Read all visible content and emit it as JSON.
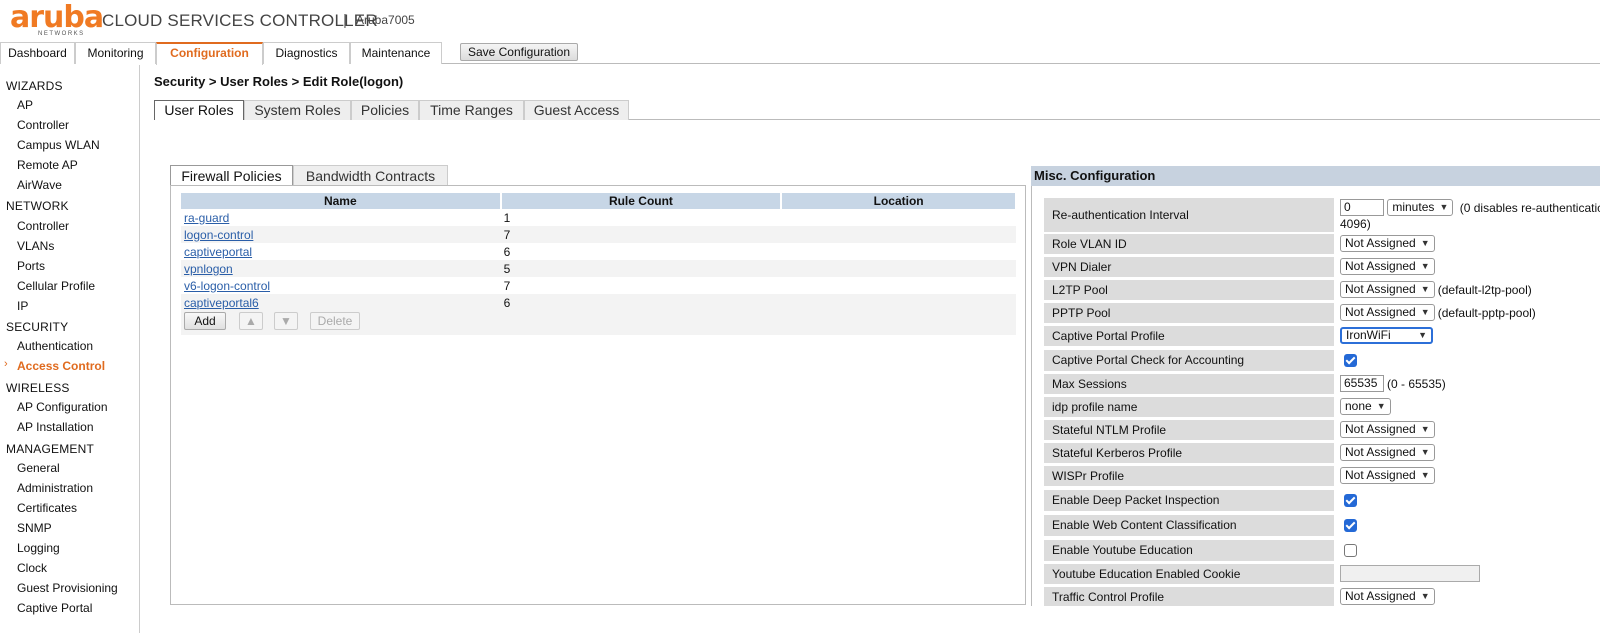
{
  "header": {
    "logo_word": "aruba",
    "logo_sub": "NETWORKS",
    "product": "CLOUD SERVICES CONTROLLER",
    "separator": "|",
    "host": "Aruba7005"
  },
  "topnav": {
    "tabs": [
      "Dashboard",
      "Monitoring",
      "Configuration",
      "Diagnostics",
      "Maintenance"
    ],
    "active": "Configuration",
    "save_label": "Save Configuration"
  },
  "sidebar": {
    "sections": [
      {
        "title": "WIZARDS",
        "items": [
          "AP",
          "Controller",
          "Campus WLAN",
          "Remote AP",
          "AirWave"
        ]
      },
      {
        "title": "NETWORK",
        "items": [
          "Controller",
          "VLANs",
          "Ports",
          "Cellular Profile",
          "IP"
        ]
      },
      {
        "title": "SECURITY",
        "items": [
          "Authentication",
          "Access Control"
        ]
      },
      {
        "title": "WIRELESS",
        "items": [
          "AP Configuration",
          "AP Installation"
        ]
      },
      {
        "title": "MANAGEMENT",
        "items": [
          "General",
          "Administration",
          "Certificates",
          "SNMP",
          "Logging",
          "Clock",
          "Guest Provisioning",
          "Captive Portal"
        ]
      }
    ],
    "active_item": "Access Control",
    "caret": "›"
  },
  "main": {
    "breadcrumb": "Security > User Roles > Edit Role(logon)",
    "subtabs": [
      "User Roles",
      "System Roles",
      "Policies",
      "Time Ranges",
      "Guest Access"
    ],
    "active_subtab": "User Roles"
  },
  "firewall": {
    "tabs": [
      "Firewall Policies",
      "Bandwidth Contracts"
    ],
    "active_tab": "Firewall Policies",
    "columns": [
      "Name",
      "Rule Count",
      "Location"
    ],
    "rows": [
      {
        "name": "ra-guard",
        "rule_count": "1",
        "location": ""
      },
      {
        "name": "logon-control",
        "rule_count": "7",
        "location": ""
      },
      {
        "name": "captiveportal",
        "rule_count": "6",
        "location": ""
      },
      {
        "name": "vpnlogon",
        "rule_count": "5",
        "location": ""
      },
      {
        "name": "v6-logon-control",
        "rule_count": "7",
        "location": ""
      },
      {
        "name": "captiveportal6",
        "rule_count": "6",
        "location": ""
      }
    ],
    "buttons": {
      "add": "Add",
      "up": "▲",
      "down": "▼",
      "delete": "Delete"
    }
  },
  "misc": {
    "title": "Misc. Configuration",
    "reauth": {
      "label": "Re-authentication Interval",
      "value": "0",
      "unit": "minutes",
      "suffix": "(0 disables re-authenticatic",
      "suffix2": "4096)"
    },
    "role_vlan": {
      "label": "Role VLAN ID",
      "value": "Not Assigned"
    },
    "vpn_dialer": {
      "label": "VPN Dialer",
      "value": "Not Assigned"
    },
    "l2tp": {
      "label": "L2TP Pool",
      "value": "Not Assigned",
      "suffix": "(default-l2tp-pool)"
    },
    "pptp": {
      "label": "PPTP Pool",
      "value": "Not Assigned",
      "suffix": "(default-pptp-pool)"
    },
    "cp_profile": {
      "label": "Captive Portal Profile",
      "value": "IronWiFi"
    },
    "cp_check": {
      "label": "Captive Portal Check for Accounting"
    },
    "max_sessions": {
      "label": "Max Sessions",
      "value": "65535",
      "suffix": "(0 - 65535)"
    },
    "idp": {
      "label": "idp profile name",
      "value": "none"
    },
    "ntlm": {
      "label": "Stateful NTLM Profile",
      "value": "Not Assigned"
    },
    "kerberos": {
      "label": "Stateful Kerberos Profile",
      "value": "Not Assigned"
    },
    "wispr": {
      "label": "WISPr Profile",
      "value": "Not Assigned"
    },
    "dpi": {
      "label": "Enable Deep Packet Inspection"
    },
    "wcc": {
      "label": "Enable Web Content Classification"
    },
    "yt_edu": {
      "label": "Enable Youtube Education"
    },
    "yt_cookie": {
      "label": "Youtube Education Enabled Cookie",
      "value": ""
    },
    "traffic": {
      "label": "Traffic Control Profile",
      "value": "Not Assigned"
    }
  },
  "colors": {
    "accent": "#e06b1f",
    "link": "#2a5ea8",
    "table_header": "#c7d6e6",
    "checkbox": "#2469d6"
  }
}
